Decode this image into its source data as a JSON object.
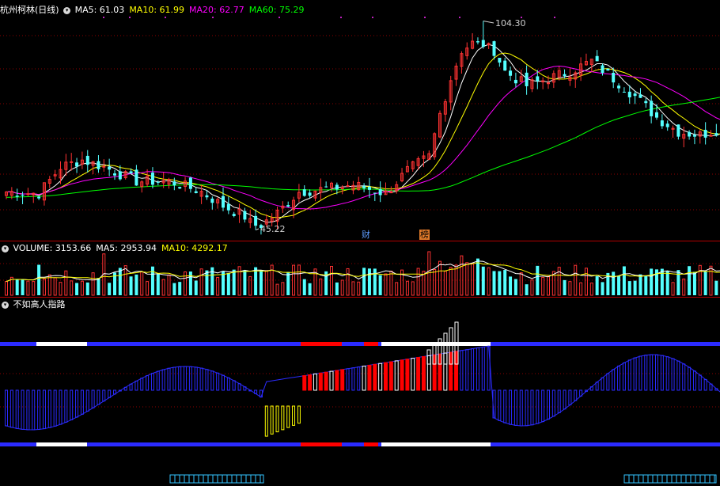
{
  "colors": {
    "up": "#ff3232",
    "down": "#54ffff",
    "ma5": "#ffffff",
    "ma10": "#ffff00",
    "ma20": "#ff00ff",
    "ma60": "#00ff00",
    "grid": "#8b0000",
    "panel_line": "#b40000",
    "signal_line": "#2b2bff",
    "signal_bar": "#ffffff",
    "signal_red": "#ff0000",
    "signal_yellow": "#ffff00"
  },
  "main_panel": {
    "title": "杭州柯林(日线)",
    "legend": [
      {
        "label": "MA5: 61.03",
        "color": "#ffffff"
      },
      {
        "label": "MA10: 61.99",
        "color": "#ffff00"
      },
      {
        "label": "MA20: 62.77",
        "color": "#ff00ff"
      },
      {
        "label": "MA60: 75.29",
        "color": "#00ff00"
      }
    ],
    "high_label": "104.30",
    "low_label": "45.22",
    "badge_finance": "财",
    "badge_list": "榜"
  },
  "volume_panel": {
    "legend": [
      {
        "label": "VOLUME: 3153.66",
        "color": "#ffffff"
      },
      {
        "label": "MA5: 2953.94",
        "color": "#ffffff"
      },
      {
        "label": "MA10: 4292.17",
        "color": "#ffff00"
      }
    ]
  },
  "indicator_panel": {
    "title": "不如高人指路"
  },
  "chart_data": [
    {
      "type": "candlestick",
      "title": "杭州柯林(日线)",
      "bars": 133,
      "price_range": [
        44,
        108
      ],
      "max_price": 104.3,
      "min_price": 45.22,
      "moving_averages": {
        "MA5": 61.03,
        "MA10": 61.99,
        "MA20": 62.77,
        "MA60": 75.29
      },
      "close_anchors": [
        [
          0,
          56
        ],
        [
          6,
          55.5
        ],
        [
          10,
          63
        ],
        [
          14,
          65
        ],
        [
          18,
          63
        ],
        [
          24,
          59
        ],
        [
          30,
          59
        ],
        [
          36,
          56
        ],
        [
          40,
          52
        ],
        [
          44,
          49
        ],
        [
          46,
          45.5
        ],
        [
          50,
          50
        ],
        [
          54,
          56
        ],
        [
          60,
          57
        ],
        [
          64,
          58
        ],
        [
          70,
          55.5
        ],
        [
          74,
          62
        ],
        [
          78,
          66
        ],
        [
          80,
          78
        ],
        [
          82,
          88
        ],
        [
          84,
          96
        ],
        [
          86,
          98
        ],
        [
          88,
          97
        ],
        [
          90,
          96
        ],
        [
          92,
          90
        ],
        [
          96,
          86
        ],
        [
          100,
          88
        ],
        [
          104,
          90
        ],
        [
          108,
          93
        ],
        [
          112,
          88
        ],
        [
          116,
          83
        ],
        [
          120,
          77
        ],
        [
          124,
          73
        ],
        [
          128,
          72
        ],
        [
          132,
          74
        ]
      ]
    },
    {
      "type": "bar",
      "title": "VOLUME",
      "volume": 3153.66,
      "MA5": 2953.94,
      "MA10": 4292.17
    },
    {
      "type": "bar",
      "title": "不如高人指路"
    }
  ]
}
